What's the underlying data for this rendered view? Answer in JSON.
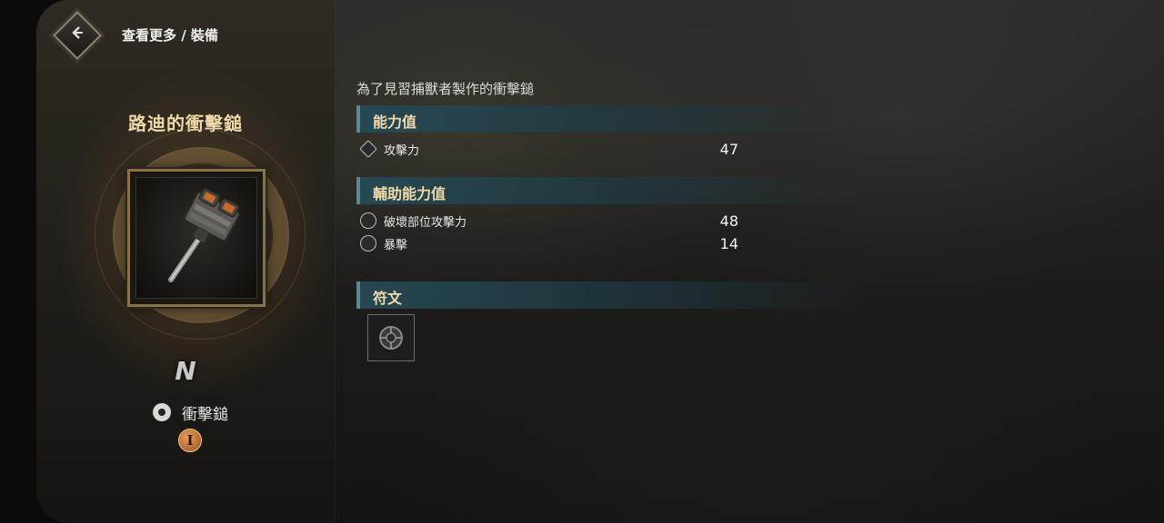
{
  "header": {
    "breadcrumb": "查看更多 / 裝備"
  },
  "item": {
    "name": "路迪的衝擊鎚",
    "rarity": "N",
    "type": "衝擊鎚",
    "tier": "I",
    "description": "為了見習捕獸者製作的衝擊鎚"
  },
  "sections": {
    "stats_title": "能力值",
    "sub_stats_title": "輔助能力值",
    "runes_title": "符文"
  },
  "stats": [
    {
      "label": "攻擊力",
      "value": "47",
      "icon": "attack-icon"
    }
  ],
  "sub_stats": [
    {
      "label": "破壞部位攻擊力",
      "value": "48",
      "icon": "break-part-icon"
    },
    {
      "label": "暴擊",
      "value": "14",
      "icon": "critical-icon"
    }
  ],
  "colors": {
    "accent_gold": "#f0d9a8",
    "section_teal": "#264a56",
    "tier_orange": "#d98a4a"
  }
}
